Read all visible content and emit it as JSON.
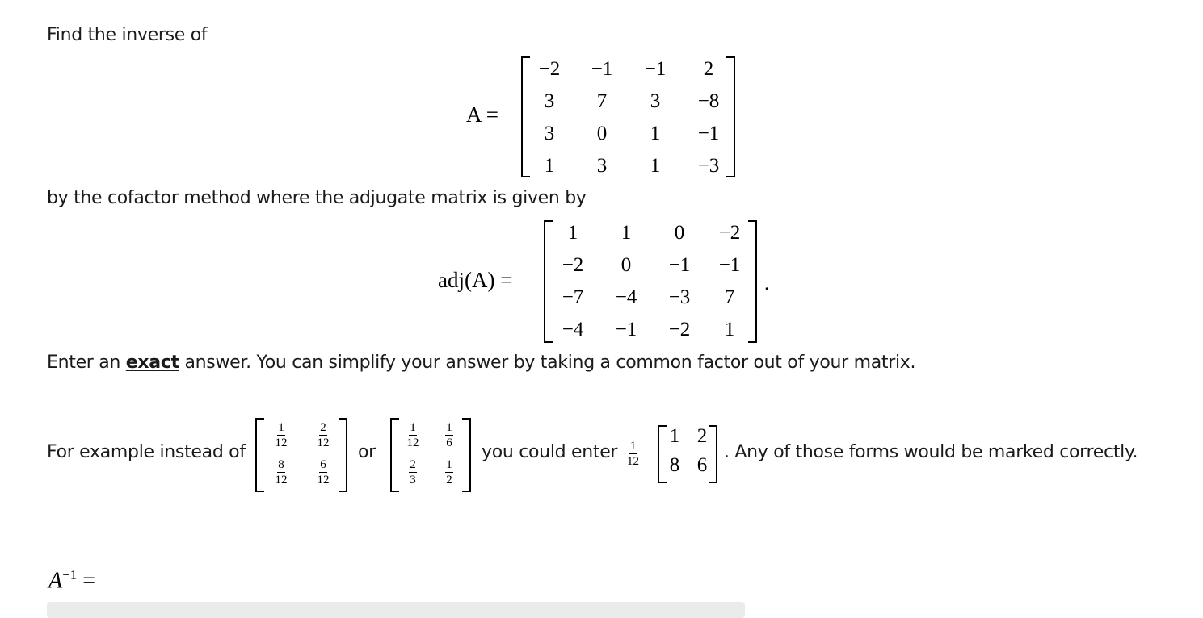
{
  "intro": "Find the inverse of",
  "matrix_A": {
    "lhs": "A =",
    "rows": [
      [
        "−2",
        "−1",
        "−1",
        "2"
      ],
      [
        "3",
        "7",
        "3",
        "−8"
      ],
      [
        "3",
        "0",
        "1",
        "−1"
      ],
      [
        "1",
        "3",
        "1",
        "−3"
      ]
    ]
  },
  "method_text": "by the cofactor method where the adjugate matrix is given by",
  "adjugate": {
    "lhs": "adj(A) =",
    "rows": [
      [
        "1",
        "1",
        "0",
        "−2"
      ],
      [
        "−2",
        "0",
        "−1",
        "−1"
      ],
      [
        "−7",
        "−4",
        "−3",
        "7"
      ],
      [
        "−4",
        "−1",
        "−2",
        "1"
      ]
    ],
    "trailing": "."
  },
  "instruction": {
    "pre": "Enter an ",
    "emphasis": "exact",
    "post": " answer. You can simplify your answer by taking a common factor out of your matrix."
  },
  "example": {
    "pre": "For example instead of",
    "matrix1": [
      [
        [
          "1",
          "12"
        ],
        [
          "2",
          "12"
        ]
      ],
      [
        [
          "8",
          "12"
        ],
        [
          "6",
          "12"
        ]
      ]
    ],
    "or": "or",
    "matrix2": [
      [
        [
          "1",
          "12"
        ],
        [
          "1",
          "6"
        ]
      ],
      [
        [
          "2",
          "3"
        ],
        [
          "1",
          "2"
        ]
      ]
    ],
    "mid": "you could enter",
    "factor": [
      "1",
      "12"
    ],
    "matrix3": [
      [
        "1",
        "2"
      ],
      [
        "8",
        "6"
      ]
    ],
    "post": ". Any of those forms would be marked correctly."
  },
  "answer": {
    "label_base": "A",
    "label_sup": "−1",
    "label_eq": "=",
    "input_value": ""
  }
}
